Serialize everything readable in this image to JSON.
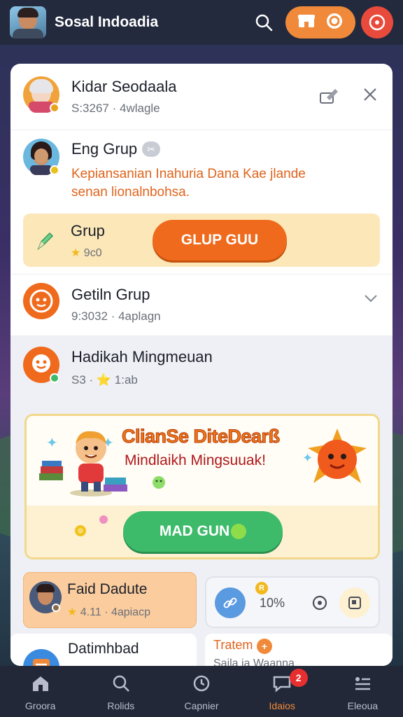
{
  "header": {
    "app_title": "Sosal Indoadia",
    "search_icon": "search-icon",
    "shop_icon": "shop-icon",
    "coin_icon": "coin-icon",
    "power_icon": "power-icon"
  },
  "feed": {
    "item1": {
      "name": "Kidar Seodaala",
      "meta": "S:3267 · 4wlagle"
    },
    "item2": {
      "name": "Eng Grup",
      "tag": "✂",
      "desc_line1": "Kepiansanian Inahuria Dana Kae jlande",
      "desc_line2": "senan lionalnbohsa."
    },
    "grup_strip": {
      "label": "Grup",
      "meta": "9c0",
      "button": "GLUP GUU"
    },
    "item3": {
      "name": "Getiln Grup",
      "meta": "9:3032 · 4aplagn"
    },
    "item4": {
      "name": "Hadikah Mingmeuan",
      "meta": "S3 · ⭐ 1:ab"
    }
  },
  "banner": {
    "title": "ClianSe DiteDearß",
    "subtitle": "Mindlaikh Mingsuuak!",
    "button": "MAD GUN"
  },
  "mini_cards": {
    "left": {
      "name": "Faid Dadute",
      "meta": "4.11 · 4apiacp"
    },
    "right": {
      "badge": "R",
      "percent": "10%"
    }
  },
  "bottom_peek": {
    "left_title": "Datimhbad",
    "right_title": "Tratem",
    "right_sub": "Saila ja Waanna"
  },
  "nav": [
    {
      "label": "Groora",
      "icon": "home-icon"
    },
    {
      "label": "Rolids",
      "icon": "search-icon"
    },
    {
      "label": "Capnier",
      "icon": "clock-icon"
    },
    {
      "label": "Idaios",
      "icon": "chat-icon",
      "badge": "2"
    },
    {
      "label": "Eleoua",
      "icon": "menu-icon"
    }
  ],
  "colors": {
    "accent": "#ef6a1c",
    "primary_bg": "#232a3e",
    "green": "#3dbb6b",
    "red": "#e84a3b"
  }
}
